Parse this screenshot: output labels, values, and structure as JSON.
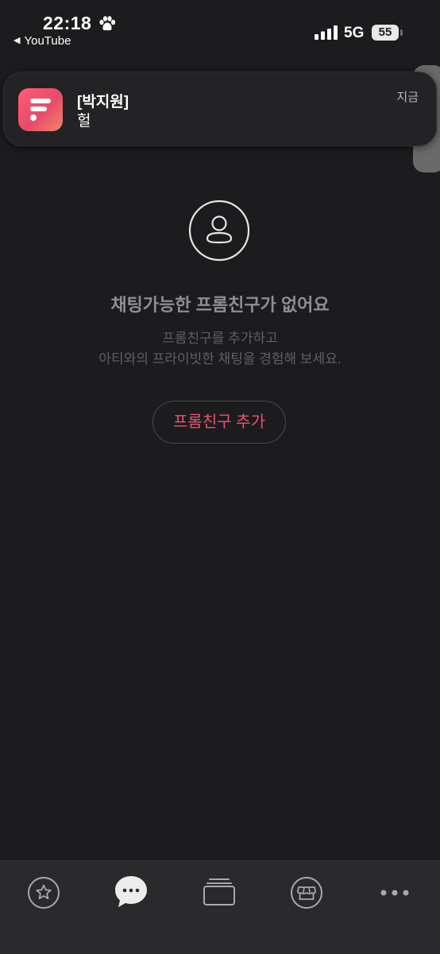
{
  "status_bar": {
    "time": "22:18",
    "back_app": "YouTube",
    "network": "5G",
    "battery": "55"
  },
  "notification": {
    "title": "[박지원]",
    "body": "헐",
    "time": "지금"
  },
  "empty_state": {
    "title": "채팅가능한 프롬친구가 없어요",
    "subtitle_line1": "프롬친구를 추가하고",
    "subtitle_line2": "아티와의 프라이빗한 채팅을 경험해 보세요.",
    "add_button_label": "프롬친구 추가"
  },
  "tabbar": {
    "items": [
      {
        "icon": "star-icon",
        "active": false
      },
      {
        "icon": "chat-bubble-icon",
        "active": true
      },
      {
        "icon": "cards-icon",
        "active": false
      },
      {
        "icon": "store-icon",
        "active": false
      },
      {
        "icon": "more-dots-icon",
        "active": false
      }
    ]
  },
  "colors": {
    "background": "#1c1c1f",
    "accent": "#e9546e",
    "tabbar": "#2a2a2d"
  }
}
